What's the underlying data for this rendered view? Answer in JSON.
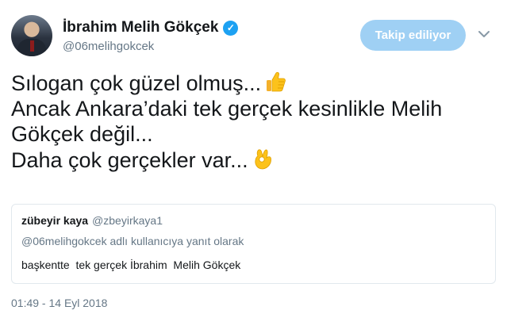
{
  "author": {
    "name": "İbrahim Melih Gökçek",
    "handle": "@06melihgokcek",
    "verified_mark": "✓"
  },
  "follow_button": {
    "label": "Takip ediliyor"
  },
  "menu": {
    "icon": "chevron-down-icon"
  },
  "tweet": {
    "lines": [
      "Sılogan çok güzel olmuş...",
      "Ancak Ankara’daki tek gerçek kesinlikle Melih",
      "Gökçek değil...",
      "Daha çok gerçekler var..."
    ],
    "emojis": [
      "thumbs-up-icon",
      "ok-hand-icon"
    ]
  },
  "quoted_tweet": {
    "name": "zübeyir kaya",
    "handle": "@zbeyirkaya1",
    "reply_context": "@06melihgokcek adlı kullanıcıya yanıt olarak",
    "text": "başkentte  tek gerçek İbrahim  Melih Gökçek"
  },
  "timestamp": "01:49 - 14 Eyl 2018",
  "colors": {
    "accent": "#1da1f2",
    "follow_button_bg": "#9fd0f4",
    "secondary_text": "#657786",
    "border": "#e1e8ed"
  }
}
